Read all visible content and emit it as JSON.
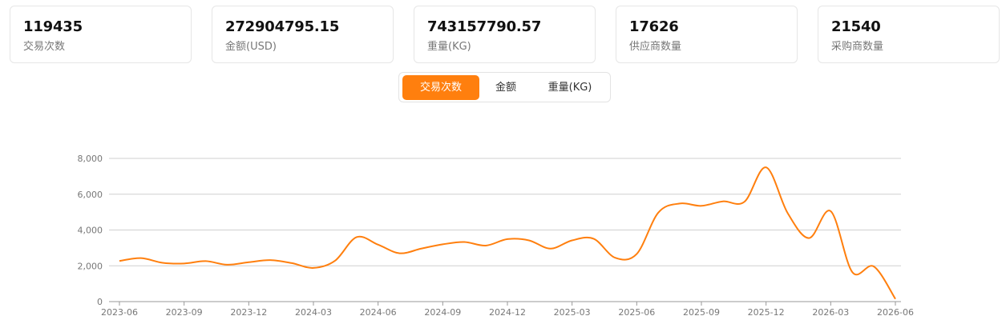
{
  "stats": [
    {
      "value": "119435",
      "label": "交易次数"
    },
    {
      "value": "272904795.15",
      "label": "金额(USD)"
    },
    {
      "value": "743157790.57",
      "label": "重量(KG)"
    },
    {
      "value": "17626",
      "label": "供应商数量"
    },
    {
      "value": "21540",
      "label": "采购商数量"
    }
  ],
  "tabs": [
    {
      "label": "交易次数",
      "active": true
    },
    {
      "label": "金额",
      "active": false
    },
    {
      "label": "重量(KG)",
      "active": false
    }
  ],
  "colors": {
    "accent": "#ff7f0e",
    "grid": "#cfcfcf",
    "axis": "#999999"
  },
  "chart_data": {
    "type": "line",
    "title": "",
    "xlabel": "",
    "ylabel": "",
    "ylim": [
      0,
      8000
    ],
    "yticks": [
      0,
      2000,
      4000,
      6000,
      8000
    ],
    "ytick_labels": [
      "0",
      "2,000",
      "4,000",
      "6,000",
      "8,000"
    ],
    "xtick_labels": [
      "2023-06",
      "2023-09",
      "2023-12",
      "2024-03",
      "2024-06",
      "2024-09",
      "2024-12",
      "2025-03",
      "2025-06",
      "2025-09",
      "2025-12",
      "2026-03",
      "2026-06"
    ],
    "grid": true,
    "series": [
      {
        "color": "#ff7f0e",
        "x": [
          "2023-06",
          "2023-07",
          "2023-08",
          "2023-09",
          "2023-10",
          "2023-11",
          "2023-12",
          "2024-01",
          "2024-02",
          "2024-03",
          "2024-04",
          "2024-05",
          "2024-06",
          "2024-07",
          "2024-08",
          "2024-09",
          "2024-10",
          "2024-11",
          "2024-12",
          "2025-01",
          "2025-02",
          "2025-03",
          "2025-04",
          "2025-05",
          "2025-06",
          "2025-07",
          "2025-08",
          "2025-09",
          "2025-10",
          "2025-11",
          "2025-12",
          "2026-01",
          "2026-02",
          "2026-03",
          "2026-04",
          "2026-05",
          "2026-06"
        ],
        "values": [
          2270,
          2430,
          2170,
          2130,
          2260,
          2060,
          2200,
          2320,
          2150,
          1880,
          2280,
          3600,
          3180,
          2700,
          2960,
          3200,
          3330,
          3130,
          3490,
          3420,
          2960,
          3420,
          3510,
          2450,
          2660,
          4970,
          5480,
          5350,
          5600,
          5580,
          7500,
          4950,
          3550,
          5050,
          1650,
          1960,
          150
        ]
      }
    ]
  }
}
